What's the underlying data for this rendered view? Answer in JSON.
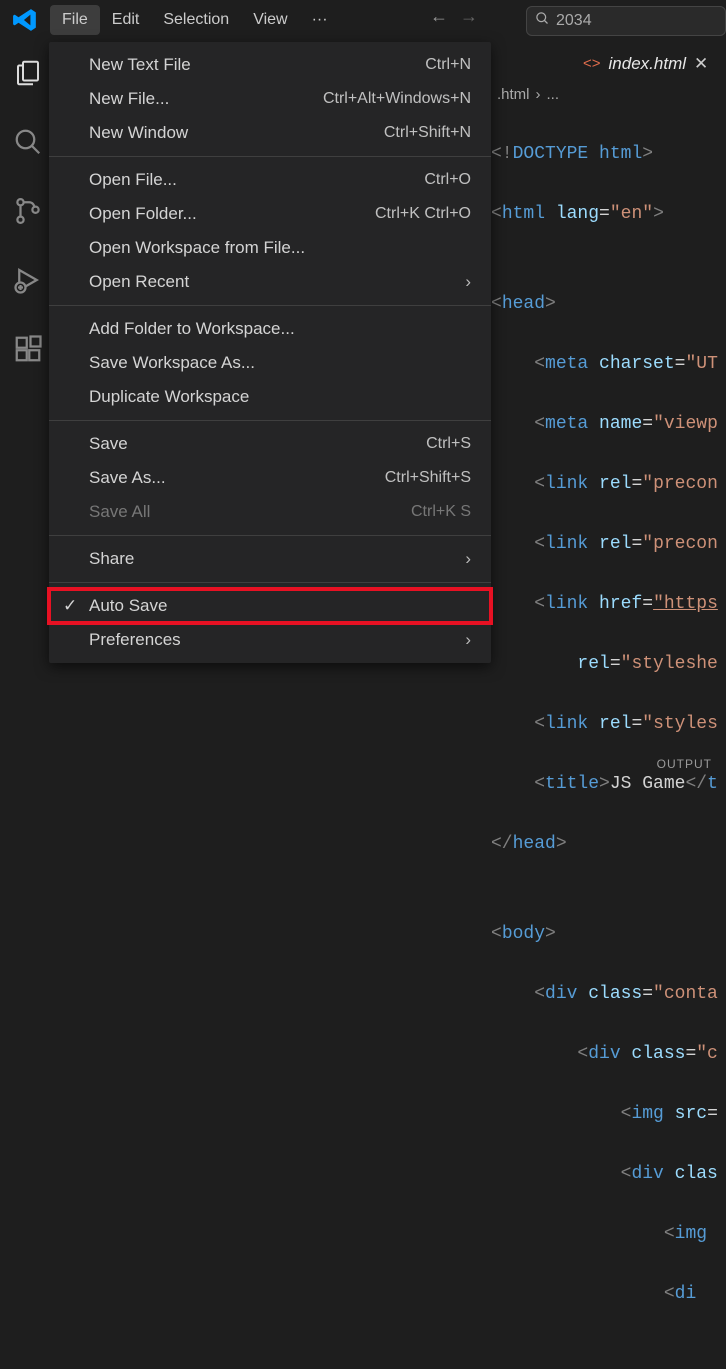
{
  "menubar": {
    "items": [
      "File",
      "Edit",
      "Selection",
      "View"
    ],
    "ellipsis": "···",
    "search_text": "2034"
  },
  "dropdown": {
    "newTextFile": {
      "label": "New Text File",
      "shortcut": "Ctrl+N"
    },
    "newFile": {
      "label": "New File...",
      "shortcut": "Ctrl+Alt+Windows+N"
    },
    "newWindow": {
      "label": "New Window",
      "shortcut": "Ctrl+Shift+N"
    },
    "openFile": {
      "label": "Open File...",
      "shortcut": "Ctrl+O"
    },
    "openFolder": {
      "label": "Open Folder...",
      "shortcut": "Ctrl+K Ctrl+O"
    },
    "openWorkspace": {
      "label": "Open Workspace from File..."
    },
    "openRecent": {
      "label": "Open Recent"
    },
    "addFolder": {
      "label": "Add Folder to Workspace..."
    },
    "saveWorkspaceAs": {
      "label": "Save Workspace As..."
    },
    "duplicateWorkspace": {
      "label": "Duplicate Workspace"
    },
    "save": {
      "label": "Save",
      "shortcut": "Ctrl+S"
    },
    "saveAs": {
      "label": "Save As...",
      "shortcut": "Ctrl+Shift+S"
    },
    "saveAll": {
      "label": "Save All",
      "shortcut": "Ctrl+K S"
    },
    "share": {
      "label": "Share"
    },
    "autoSave": {
      "label": "Auto Save"
    },
    "preferences": {
      "label": "Preferences"
    }
  },
  "tab": {
    "name": "index.html"
  },
  "breadcrumb": {
    "b1": ".html",
    "b2": "..."
  },
  "code": {
    "l1a": "<!",
    "l1b": "DOCTYPE",
    "l1c": " html",
    "l1d": ">",
    "l2a": "<",
    "l2b": "html",
    "l2c": " lang",
    "l2d": "=",
    "l2e": "\"en\"",
    "l2f": ">",
    "l3": "",
    "l4a": "<",
    "l4b": "head",
    "l4c": ">",
    "l5a": "    <",
    "l5b": "meta",
    "l5c": " charset",
    "l5d": "=",
    "l5e": "\"UT",
    "l6a": "    <",
    "l6b": "meta",
    "l6c": " name",
    "l6d": "=",
    "l6e": "\"viewp",
    "l7a": "    <",
    "l7b": "link",
    "l7c": " rel",
    "l7d": "=",
    "l7e": "\"precon",
    "l8a": "    <",
    "l8b": "link",
    "l8c": " rel",
    "l8d": "=",
    "l8e": "\"precon",
    "l9a": "    <",
    "l9b": "link",
    "l9c": " href",
    "l9d": "=",
    "l9e": "\"https",
    "l10a": "        rel",
    "l10b": "=",
    "l10c": "\"styleshe",
    "l11a": "    <",
    "l11b": "link",
    "l11c": " rel",
    "l11d": "=",
    "l11e": "\"styles",
    "l12a": "    <",
    "l12b": "title",
    "l12c": ">",
    "l12d": "JS Game",
    "l12e": "</",
    "l12f": "t",
    "l13a": "</",
    "l13b": "head",
    "l13c": ">",
    "l14": "",
    "l15a": "<",
    "l15b": "body",
    "l15c": ">",
    "l16a": "    <",
    "l16b": "div",
    "l16c": " class",
    "l16d": "=",
    "l16e": "\"conta",
    "l17a": "        <",
    "l17b": "div",
    "l17c": " class",
    "l17d": "=",
    "l17e": "\"c",
    "l18a": "            <",
    "l18b": "img",
    "l18c": " src",
    "l18d": "=",
    "l19a": "            <",
    "l19b": "div",
    "l19c": " clas",
    "l20a": "                <",
    "l20b": "img",
    "l21a": "                <",
    "l21b": "di"
  },
  "panel": {
    "t1": "OUTPUT"
  }
}
